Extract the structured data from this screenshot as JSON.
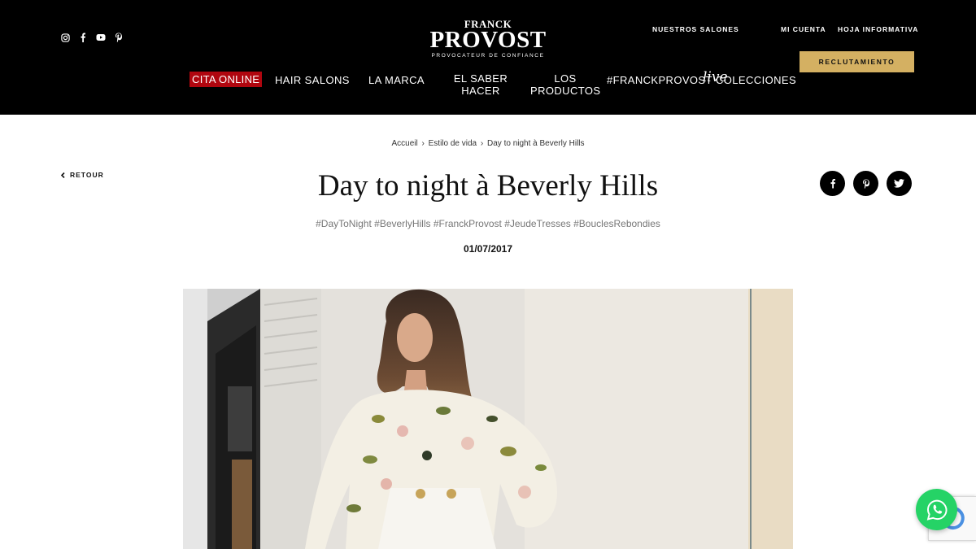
{
  "header": {
    "brand": {
      "top": "FRANCK",
      "main": "PROVOST",
      "tagline": "PROVOCATEUR DE CONFIANCE"
    },
    "social_icons": [
      "instagram-icon",
      "facebook-icon",
      "youtube-icon",
      "pinterest-icon"
    ],
    "top_links": {
      "salones": "NUESTROS SALONES",
      "cuenta": "MI CUENTA",
      "hoja": "HOJA INFORMATIVA"
    },
    "recruit_button": "RECLUTAMIENTO",
    "nav": {
      "cita": "CITA ONLINE",
      "hair_salons": "HAIR SALONS",
      "la_marca": "LA MARCA",
      "saber_hacer_1": "EL SABER",
      "saber_hacer_2": "HACER",
      "productos_1": "LOS",
      "productos_2": "PRODUCTOS",
      "hashtag": "#FRANCKPROVOST",
      "live": "live",
      "colecciones": "COLECCIONES"
    }
  },
  "article": {
    "breadcrumb": [
      "Accueil",
      "Estilo de vida",
      "Day to night à Beverly Hills"
    ],
    "breadcrumb_sep": "›",
    "back_label": "RETOUR",
    "title": "Day to night à Beverly Hills",
    "hashtags": "#DayToNight #BeverlyHills #FranckProvost #JeudeTresses #BouclesRebondies",
    "date": "01/07/2017",
    "share_icons": [
      "facebook-icon",
      "pinterest-icon",
      "twitter-icon"
    ]
  },
  "colors": {
    "header_bg": "#000000",
    "accent_gold": "#d4b062",
    "cita_red": "#b0060f",
    "whatsapp_green": "#25d366"
  }
}
